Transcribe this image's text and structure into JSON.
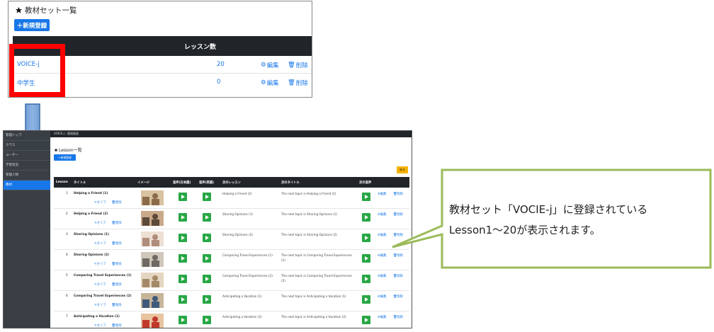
{
  "top_panel": {
    "title": "教材セット一覧",
    "new_button": "＋新規登録",
    "headers": {
      "name": "",
      "count": "レッスン数"
    },
    "rows": [
      {
        "name": "VOICE-j",
        "count": "20",
        "edit": "編集",
        "delete": "削除"
      },
      {
        "name": "中学生",
        "count": "0",
        "edit": "編集",
        "delete": "削除"
      }
    ]
  },
  "sidebar": {
    "items": [
      "管理トップ",
      "クラス",
      "ユーザー",
      "学習状況",
      "管理人物",
      "教材"
    ]
  },
  "breadcrumb": "VOICE-j  ›  管理画面",
  "lesson_page": {
    "title": "Lesson一覧",
    "new_button": "＋新規登録",
    "back_button": "戻る",
    "headers": [
      "Lesson",
      "タイトル",
      "イメージ",
      "音声(日本語)",
      "音声(英語)",
      "次のレッスン",
      "次のタイトル",
      "次の音声"
    ],
    "link_serif": "セリフ",
    "link_delete": "削除",
    "row_edit": "編集",
    "row_delete": "削除",
    "rows": [
      {
        "num": "1",
        "title": "Helping a Friend (1)",
        "next": "Helping a Friend (2)",
        "next_title": "The next topic is Helping a Friend (2)"
      },
      {
        "num": "2",
        "title": "Helping a Friend (2)",
        "next": "Sharing Opinions (1)",
        "next_title": "The next topic is Sharing Opinions (1)"
      },
      {
        "num": "3",
        "title": "Sharing Opinions (1)",
        "next": "Sharing Opinions (2)",
        "next_title": "The next topic is Sharing Opinions (2)"
      },
      {
        "num": "4",
        "title": "Sharing Opinions (2)",
        "next": "Comparing Travel Experiences (1)",
        "next_title": "The next topic is Comparing Travel Experiences (1)"
      },
      {
        "num": "5",
        "title": "Comparing Travel Experiences (1)",
        "next": "Comparing Travel Experiences (2)",
        "next_title": "The next topic is Comparing Travel Experiences (2)"
      },
      {
        "num": "6",
        "title": "Comparing Travel Experiences (2)",
        "next": "Anticipating a Vacation (1)",
        "next_title": "The next topic is Anticipating a Vacation (1)"
      },
      {
        "num": "7",
        "title": "Anticipating a Vacation (1)",
        "next": "Anticipating a Vacation (2)",
        "next_title": "The next topic is Anticipating a Vacation (2)"
      }
    ]
  },
  "callout": {
    "line1": "教材セット「VOCIE-j」に登録されている",
    "line2": "Lesson1～20が表示されます。"
  },
  "colors": {
    "accent": "#1877e8",
    "highlight": "#ff0000",
    "callout_border": "#9bbb59",
    "play": "#28a745",
    "back": "#f6b200"
  }
}
